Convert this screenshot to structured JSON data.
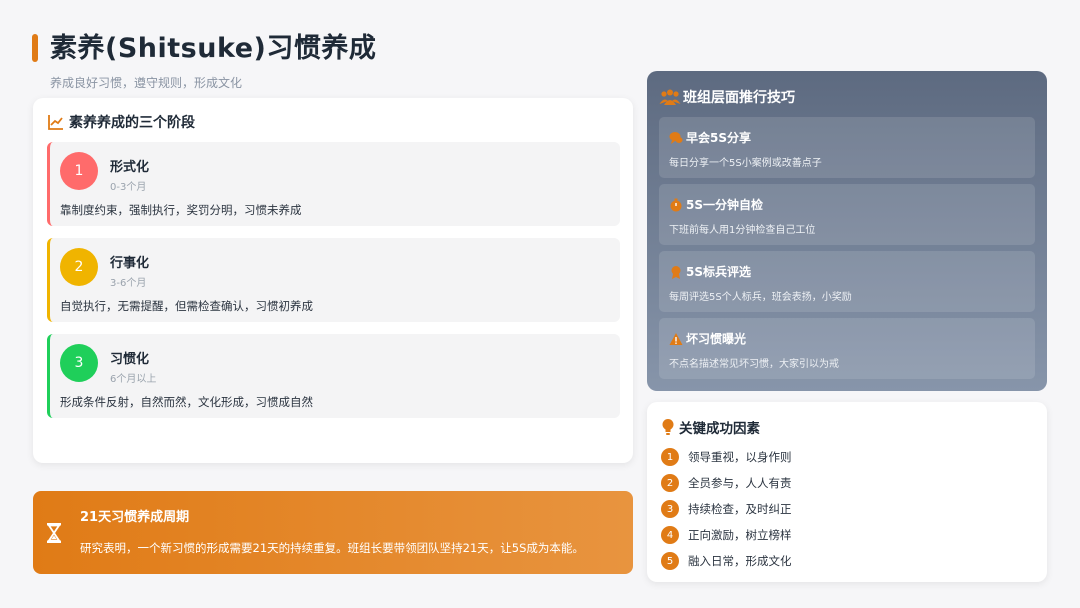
{
  "header": {
    "title": "素养(Shitsuke)习惯养成",
    "subtitle": "养成良好习惯，遵守规则，形成文化"
  },
  "stages_card": {
    "heading": "素养养成的三个阶段",
    "stages": [
      {
        "num": "1",
        "name": "形式化",
        "period": "0-3个月",
        "desc": "靠制度约束，强制执行，奖罚分明，习惯未养成",
        "color": "#ff6b6b"
      },
      {
        "num": "2",
        "name": "行事化",
        "period": "3-6个月",
        "desc": "自觉执行，无需提醒，但需检查确认，习惯初养成",
        "color": "#f0b400"
      },
      {
        "num": "3",
        "name": "习惯化",
        "period": "6个月以上",
        "desc": "形成条件反射，自然而然，文化形成，习惯成自然",
        "color": "#1fcf5a"
      }
    ]
  },
  "cycle": {
    "title": "21天习惯养成周期",
    "text": "研究表明，一个新习惯的形成需要21天的持续重复。班组长要带领团队坚持21天，让5S成为本能。"
  },
  "tips_card": {
    "heading": "班组层面推行技巧",
    "tips": [
      {
        "name": "早会5S分享",
        "desc": "每日分享一个5S小案例或改善点子",
        "icon": "chat-icon"
      },
      {
        "name": "5S一分钟自检",
        "desc": "下班前每人用1分钟检查自己工位",
        "icon": "stopwatch-icon"
      },
      {
        "name": "5S标兵评选",
        "desc": "每周评选5S个人标兵，班会表扬，小奖励",
        "icon": "medal-icon"
      },
      {
        "name": "坏习惯曝光",
        "desc": "不点名描述常见坏习惯，大家引以为戒",
        "icon": "warning-icon"
      }
    ]
  },
  "factors_card": {
    "heading": "关键成功因素",
    "items": [
      {
        "num": "1",
        "text": "领导重视，以身作则"
      },
      {
        "num": "2",
        "text": "全员参与，人人有责"
      },
      {
        "num": "3",
        "text": "持续检查，及时纠正"
      },
      {
        "num": "4",
        "text": "正向激励，树立榜样"
      },
      {
        "num": "5",
        "text": "融入日常，形成文化"
      }
    ]
  },
  "colors": {
    "accent": "#e07b16",
    "stage1": "#ff6b6b",
    "stage2": "#f0b400",
    "stage3": "#1fcf5a"
  }
}
